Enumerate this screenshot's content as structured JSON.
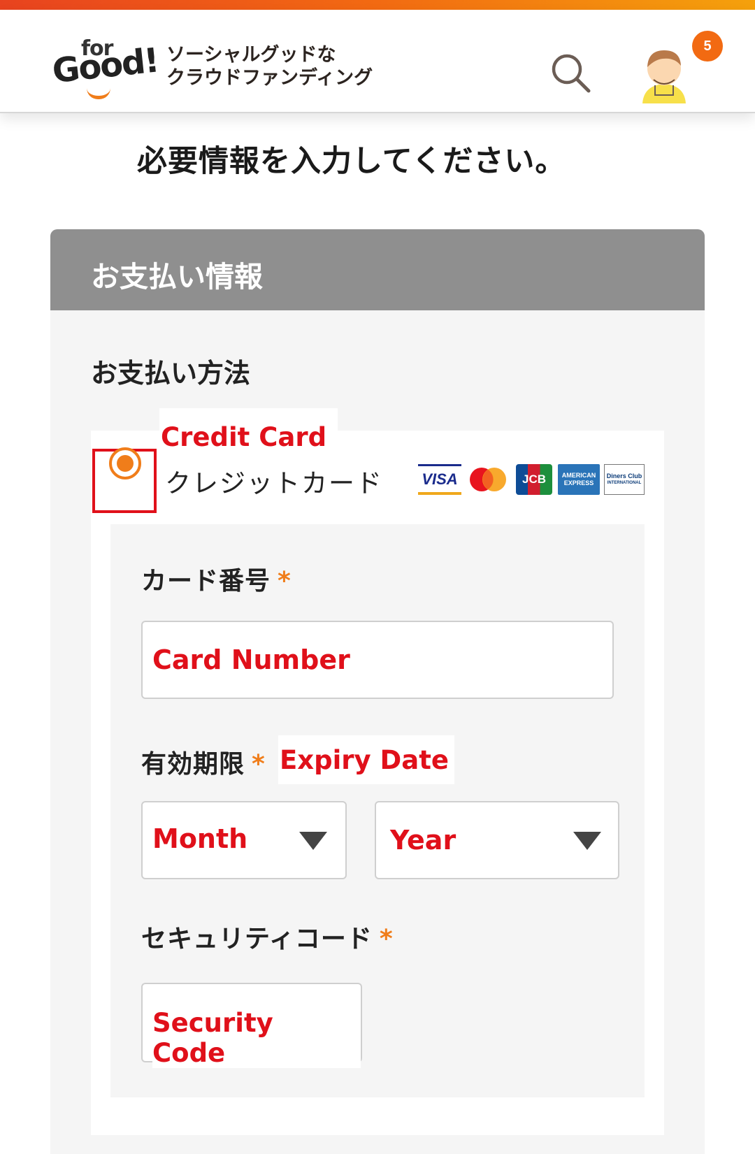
{
  "header": {
    "logo_for": "for",
    "logo_good": "Good!",
    "tagline_line1": "ソーシャルグッドな",
    "tagline_line2": "クラウドファンディング",
    "notification_count": "5",
    "colors": {
      "brand_orange": "#f07d1a",
      "badge": "#f26a12"
    }
  },
  "page": {
    "title": "必要情報を入力してください。"
  },
  "payment": {
    "section_title": "お支払い情報",
    "method_label": "お支払い方法",
    "credit_card": {
      "annotation": "Credit Card",
      "label": "クレジットカード",
      "selected": true,
      "card_brands": [
        "VISA",
        "Mastercard",
        "JCB",
        "AMERICAN EXPRESS",
        "Diners Club INTERNATIONAL"
      ],
      "visa_text": "VISA",
      "jcb_text": "JCB",
      "amex_line1": "AMERICAN",
      "amex_line2": "EXPRESS",
      "diners_line1": "Diners Club",
      "diners_line2": "INTERNATIONAL"
    },
    "card_number": {
      "label": "カード番号",
      "required_mark": "*",
      "placeholder": "Card Number"
    },
    "expiry": {
      "label": "有効期限",
      "required_mark": "*",
      "annotation": "Expiry Date",
      "month_placeholder": "Month",
      "year_placeholder": "Year"
    },
    "security_code": {
      "label": "セキュリティコード",
      "required_mark": "*",
      "placeholder": "Security Code"
    }
  }
}
